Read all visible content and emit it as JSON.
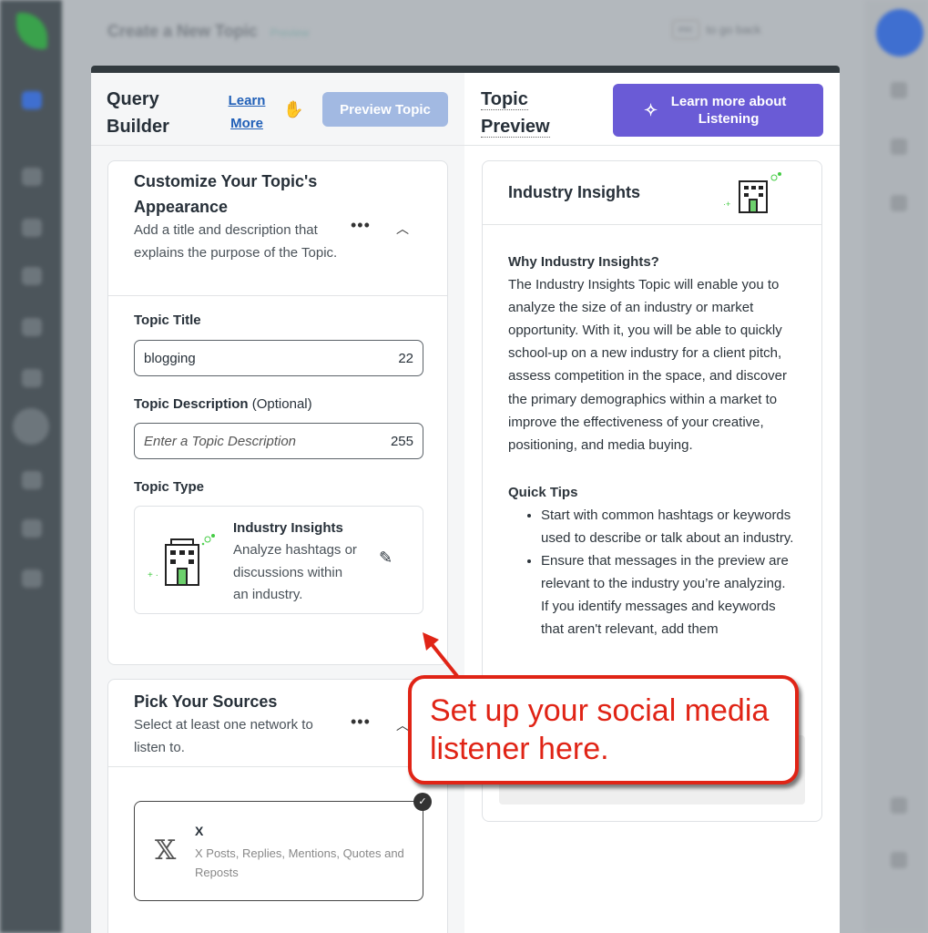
{
  "background": {
    "title": "Create a New Topic",
    "badge": "Preview",
    "esc_key": "esc",
    "esc_hint": "to go back"
  },
  "query_builder": {
    "title": "Query Builder",
    "learn_more": "Learn More",
    "preview_button": "Preview Topic",
    "appearance": {
      "heading": "Customize Your Topic's Appearance",
      "description": "Add a title and description that explains the purpose of the Topic.",
      "title_label": "Topic Title",
      "title_value": "blogging",
      "title_count": "22",
      "desc_label": "Topic Description",
      "desc_optional": "(Optional)",
      "desc_placeholder": "Enter a Topic Description",
      "desc_count": "255",
      "type_label": "Topic Type",
      "type_name": "Industry Insights",
      "type_desc": "Analyze hashtags or discussions within an industry."
    },
    "sources": {
      "heading": "Pick Your Sources",
      "description": "Select at least one network to listen to.",
      "network_name": "X",
      "network_desc": "X Posts, Replies, Mentions, Quotes and Reposts",
      "selected": true
    }
  },
  "topic_preview": {
    "title": "Topic Preview",
    "learn_button": "Learn more about Listening",
    "card_title": "Industry Insights",
    "why_heading": "Why Industry Insights?",
    "why_body": "The Industry Insights Topic will enable you to analyze the size of an industry or market opportunity. With it, you will be able to quickly school-up on a new industry for a client pitch, assess competition in the space, and discover the primary demographics within a market to improve the effectiveness of your creative, positioning, and media buying.",
    "tips_heading": "Quick Tips",
    "tips": [
      "Start with common hashtags or keywords used to describe or talk about an industry.",
      "Ensure that messages in the preview are relevant to the industry you’re analyzing. If you identify messages and keywords that aren't relevant, add them"
    ]
  },
  "annotation": {
    "text": "Set up your social media listener here.",
    "color": "#e02416"
  },
  "colors": {
    "accent": "#6a5bd6",
    "link": "#2160b8"
  }
}
